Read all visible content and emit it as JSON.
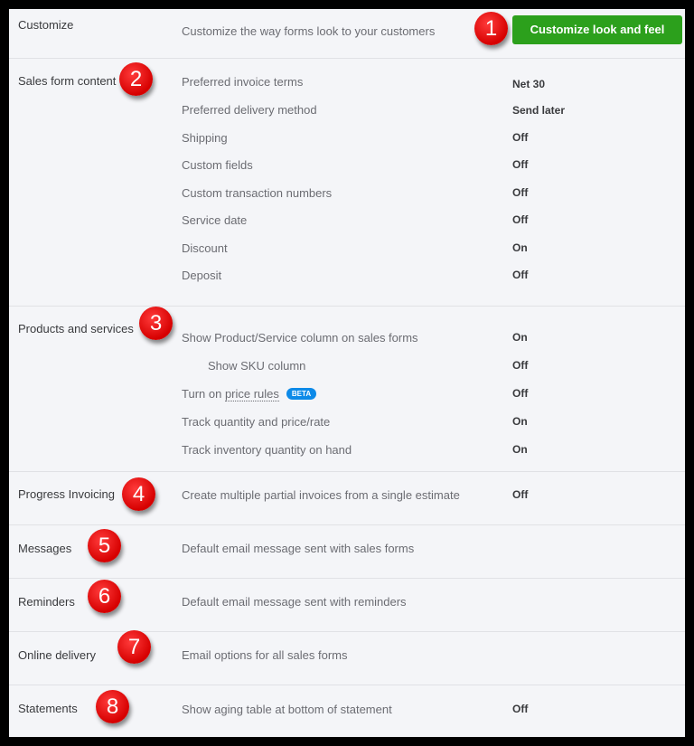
{
  "customize": {
    "title": "Customize",
    "description": "Customize the way forms look to your customers",
    "button_label": "Customize look and feel",
    "badge": "1"
  },
  "sales_form_content": {
    "title": "Sales form content",
    "badge": "2",
    "rows": [
      {
        "label": "Preferred invoice terms",
        "value": "Net 30"
      },
      {
        "label": "Preferred delivery method",
        "value": "Send later"
      },
      {
        "label": "Shipping",
        "value": "Off"
      },
      {
        "label": "Custom fields",
        "value": "Off"
      },
      {
        "label": "Custom transaction numbers",
        "value": "Off"
      },
      {
        "label": "Service date",
        "value": "Off"
      },
      {
        "label": "Discount",
        "value": "On"
      },
      {
        "label": "Deposit",
        "value": "Off"
      }
    ]
  },
  "products_services": {
    "title": "Products and services",
    "badge": "3",
    "rows": [
      {
        "label": "Show Product/Service column on sales forms",
        "value": "On"
      },
      {
        "label": "Show SKU column",
        "value": "Off"
      },
      {
        "label_prefix": "Turn on ",
        "label_link": "price rules",
        "tag": "BETA",
        "value": "Off"
      },
      {
        "label": "Track quantity and price/rate",
        "value": "On"
      },
      {
        "label": "Track inventory quantity on hand",
        "value": "On"
      }
    ]
  },
  "progress_invoicing": {
    "title": "Progress Invoicing",
    "badge": "4",
    "description": "Create multiple partial invoices from a single estimate",
    "value": "Off"
  },
  "messages": {
    "title": "Messages",
    "badge": "5",
    "description": "Default email message sent with sales forms"
  },
  "reminders": {
    "title": "Reminders",
    "badge": "6",
    "description": "Default email message sent with reminders"
  },
  "online_delivery": {
    "title": "Online delivery",
    "badge": "7",
    "description": "Email options for all sales forms"
  },
  "statements": {
    "title": "Statements",
    "badge": "8",
    "description": "Show aging table at bottom of statement",
    "value": "Off"
  },
  "colors": {
    "accent_green": "#2ca01c",
    "badge_red": "#e00000",
    "beta_blue": "#0d8ae8"
  }
}
